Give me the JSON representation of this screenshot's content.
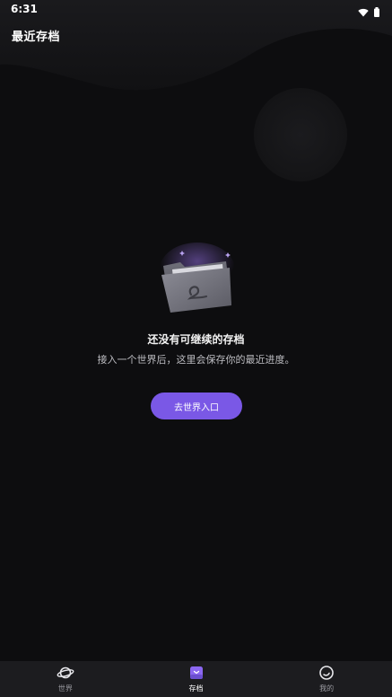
{
  "status_bar": {
    "time": "6:31",
    "icons": [
      "wifi-icon",
      "battery-icon"
    ]
  },
  "header": {
    "title": "最近存档"
  },
  "empty_state": {
    "illustration": "empty-folder-icon",
    "title": "还没有可继续的存档",
    "subtitle": "接入一个世界后，这里会保存你的最近进度。",
    "cta_label": "去世界入口"
  },
  "bottom_nav": {
    "items": [
      {
        "label": "世界",
        "icon": "planet-icon",
        "active": false
      },
      {
        "label": "存档",
        "icon": "archive-icon",
        "active": true
      },
      {
        "label": "我的",
        "icon": "profile-icon",
        "active": false
      }
    ]
  },
  "colors": {
    "background": "#0d0d0f",
    "accent": "#7a58e6",
    "nav_background": "#1c1c1f"
  }
}
